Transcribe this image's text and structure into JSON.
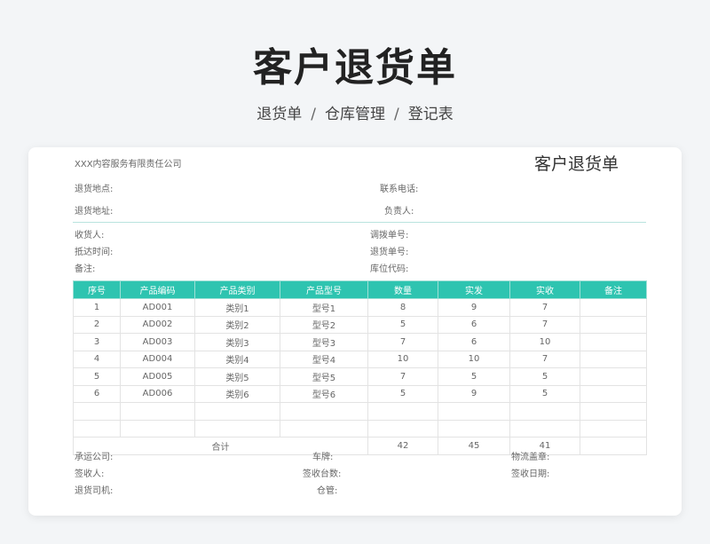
{
  "hero": {
    "title": "客户退货单",
    "breadcrumb": [
      "退货单",
      "仓库管理",
      "登记表"
    ],
    "separator": "/"
  },
  "doc": {
    "company": "XXX内容服务有限责任公司",
    "title": "客户退货单",
    "fields": {
      "return_place": "退货地点:",
      "contact_phone": "联系电话:",
      "return_address": "退货地址:",
      "person_in_charge": "负责人:",
      "receiver": "收货人:",
      "transfer_no": "调拨单号:",
      "arrival_time": "抵达时间:",
      "return_no": "退货单号:",
      "remark": "备注:",
      "location_code": "库位代码:"
    },
    "table": {
      "headers": [
        "序号",
        "产品编码",
        "产品类别",
        "产品型号",
        "数量",
        "实发",
        "实收",
        "备注"
      ],
      "rows": [
        [
          "1",
          "AD001",
          "类别1",
          "型号1",
          "8",
          "9",
          "7",
          ""
        ],
        [
          "2",
          "AD002",
          "类别2",
          "型号2",
          "5",
          "6",
          "7",
          ""
        ],
        [
          "3",
          "AD003",
          "类别3",
          "型号3",
          "7",
          "6",
          "10",
          ""
        ],
        [
          "4",
          "AD004",
          "类别4",
          "型号4",
          "10",
          "10",
          "7",
          ""
        ],
        [
          "5",
          "AD005",
          "类别5",
          "型号5",
          "7",
          "5",
          "5",
          ""
        ],
        [
          "6",
          "AD006",
          "类别6",
          "型号6",
          "5",
          "9",
          "5",
          ""
        ],
        [
          "",
          "",
          "",
          "",
          "",
          "",
          "",
          ""
        ],
        [
          "",
          "",
          "",
          "",
          "",
          "",
          "",
          ""
        ]
      ],
      "total": {
        "label": "合计",
        "qty": "42",
        "shipped": "45",
        "received": "41",
        "remark": ""
      }
    },
    "footer": {
      "carrier": "承运公司:",
      "plate": "车牌:",
      "logistics_seal": "物流盖章:",
      "signer": "签收人:",
      "signed_count": "签收台数:",
      "sign_date": "签收日期:",
      "driver": "退货司机:",
      "warehouse_keeper": "仓管:"
    }
  }
}
